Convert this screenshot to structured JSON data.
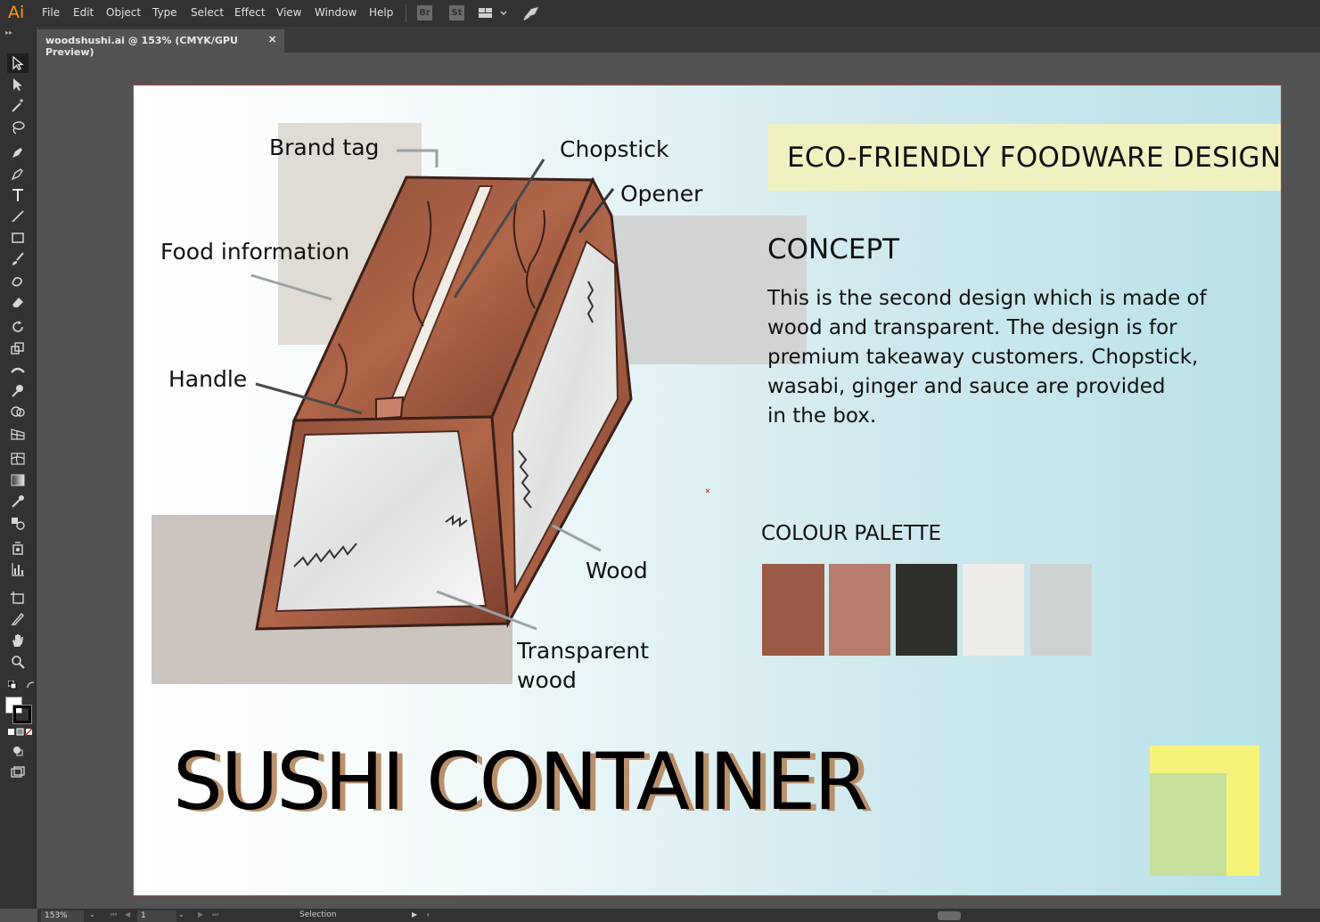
{
  "app": {
    "logo": "Ai",
    "menu": [
      "File",
      "Edit",
      "Object",
      "Type",
      "Select",
      "Effect",
      "View",
      "Window",
      "Help"
    ],
    "bridge_label": "Br",
    "stock_label": "St"
  },
  "document_tab": {
    "title": "woodshushi.ai @ 153% (CMYK/GPU Preview)",
    "close_glyph": "✕"
  },
  "toolbar": {
    "tools": [
      "selection",
      "direct-selection",
      "magic-wand",
      "lasso",
      "pen",
      "curvature",
      "type",
      "line-segment",
      "rectangle",
      "paintbrush",
      "shaper",
      "eraser",
      "rotate",
      "scale",
      "width",
      "puppet-warp",
      "shape-builder",
      "perspective-grid",
      "mesh",
      "gradient",
      "eyedropper",
      "blend",
      "symbol-sprayer",
      "column-graph",
      "artboard",
      "slice",
      "hand",
      "zoom"
    ]
  },
  "artboard": {
    "eco_title": "ECO-FRIENDLY FOODWARE DESIGN",
    "concept_heading": "CONCEPT",
    "concept_lines": [
      "This is the second design which is made of",
      "wood and transparent. The design is for",
      "premium takeaway customers. Chopstick,",
      "wasabi, ginger and sauce are provided",
      "in the box."
    ],
    "callouts": {
      "brand_tag": "Brand tag",
      "chopstick": "Chopstick",
      "opener": "Opener",
      "food_information": "Food information",
      "handle": "Handle",
      "wood": "Wood",
      "transparent_line1": "Transparent",
      "transparent_line2": "wood"
    },
    "palette_heading": "COLOUR PALETTE",
    "palette_colors": [
      "#9b5b46",
      "#b87c6d",
      "#2f302c",
      "#efedea",
      "#cdd1d0"
    ],
    "main_title": "SUSHI CONTAINER"
  },
  "statusbar": {
    "zoom": "153%",
    "artboard_number": "1",
    "tool_name": "Selection"
  }
}
